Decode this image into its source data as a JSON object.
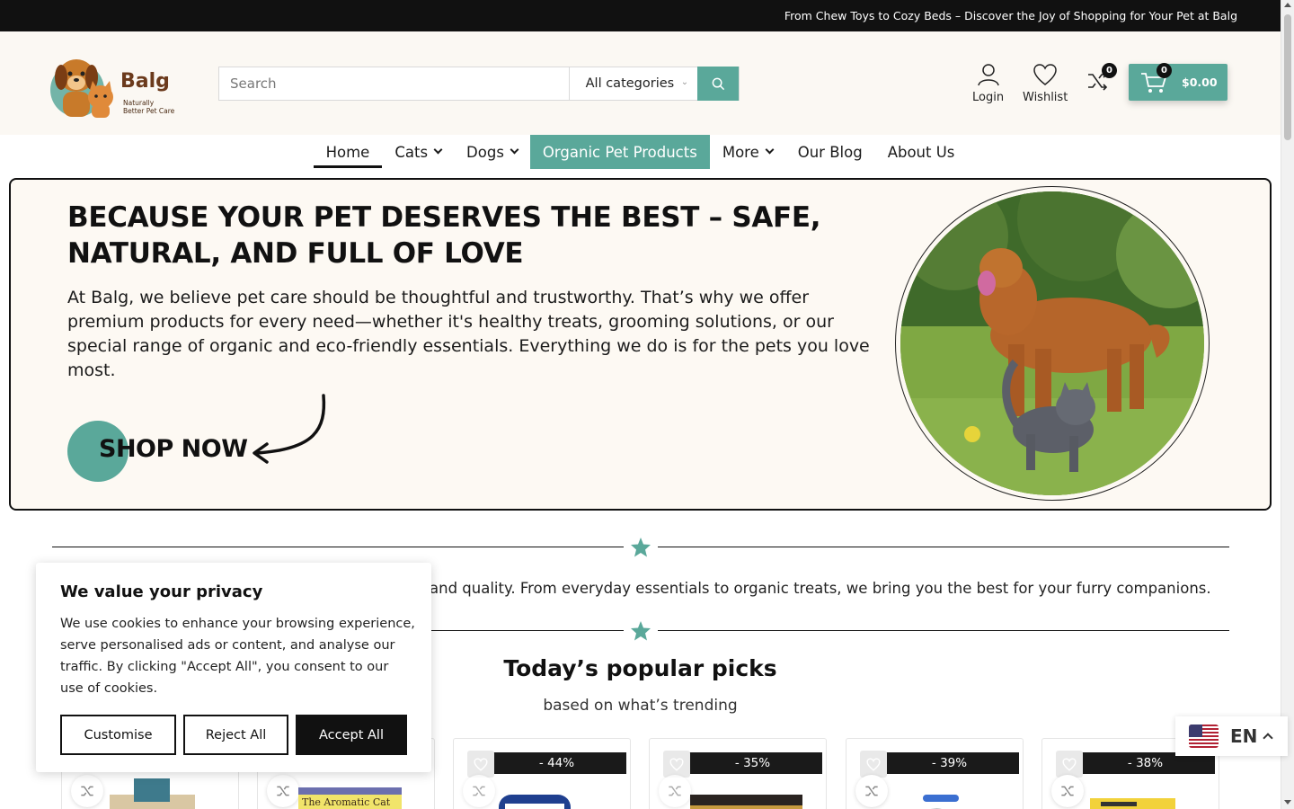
{
  "topbar": {
    "announcement": "From Chew Toys to Cozy Beds – Discover the Joy of Shopping for Your Pet at Balg"
  },
  "logo": {
    "name": "Balg",
    "tagline_line1": "Naturally",
    "tagline_line2": "Better Pet Care"
  },
  "search": {
    "placeholder": "Search",
    "category_selected": "All categories"
  },
  "header_actions": {
    "login_label": "Login",
    "wishlist_label": "Wishlist",
    "compare_count": "0",
    "cart_count": "0",
    "cart_total": "$0.00"
  },
  "nav": {
    "items": [
      {
        "label": "Home"
      },
      {
        "label": "Cats"
      },
      {
        "label": "Dogs"
      },
      {
        "label": "Organic Pet Products"
      },
      {
        "label": "More"
      },
      {
        "label": "Our Blog"
      },
      {
        "label": "About Us"
      }
    ]
  },
  "hero": {
    "title": "BECAUSE YOUR PET DESERVES THE BEST – SAFE, NATURAL, AND FULL OF LOVE",
    "text": "At Balg, we believe pet care should be thoughtful and trustworthy. That’s why we offer premium products for every need—whether it's healthy treats, grooming solutions, or our special range of organic and eco-friendly essentials. Everything we do is for the pets you love most.",
    "cta": "SHOP NOW"
  },
  "intro": {
    "tagline_visible": "and quality. From everyday essentials to organic treats, we bring you the best for your furry companions."
  },
  "popular": {
    "title": "Today’s popular picks",
    "subtitle": "based on what’s trending",
    "products": [
      {
        "discount": ""
      },
      {
        "discount": "",
        "brand_label": "The Aromatic Cat"
      },
      {
        "discount": "- 44%"
      },
      {
        "discount": "- 35%"
      },
      {
        "discount": "- 39%"
      },
      {
        "discount": "- 38%"
      }
    ]
  },
  "cookie": {
    "title": "We value your privacy",
    "text": "We use cookies to enhance your browsing experience, serve personalised ads or content, and analyse our traffic. By clicking \"Accept All\", you consent to our use of cookies.",
    "customise": "Customise",
    "reject": "Reject All",
    "accept": "Accept All"
  },
  "language": {
    "code": "EN"
  },
  "colors": {
    "accent": "#5aa89a",
    "dark": "#111111",
    "cream": "#fdf9f3"
  }
}
